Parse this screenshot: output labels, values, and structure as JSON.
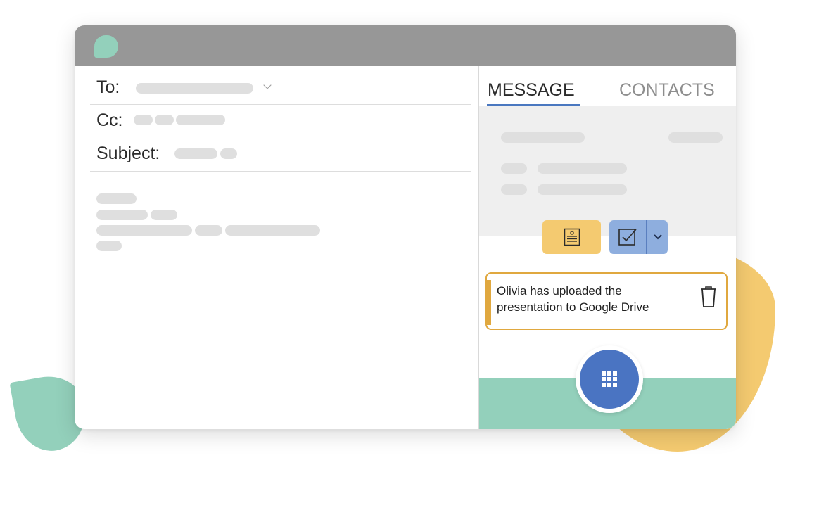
{
  "colors": {
    "titlebar": "#979797",
    "logo": "#93d0bb",
    "accent_blue": "#4a74c2",
    "notes_button": "#f4ca70",
    "task_button": "#8eaede",
    "notification_border": "#e0a83f",
    "teal": "#93d0bb",
    "blob_yellow": "#f4ca70"
  },
  "compose": {
    "to_label": "To:",
    "cc_label": "Cc:",
    "subject_label": "Subject:"
  },
  "panel": {
    "tabs": [
      {
        "label": "MESSAGE",
        "active": true
      },
      {
        "label": "CONTACTS",
        "active": false
      }
    ],
    "buttons": {
      "notes_icon": "document-icon",
      "task_icon": "checkbox-icon",
      "dropdown_icon": "chevron-down-icon"
    },
    "notification": {
      "text": "Olivia has uploaded the presentation to Google Drive",
      "icon": "trash-icon"
    },
    "fab_icon": "apps-grid-icon"
  }
}
